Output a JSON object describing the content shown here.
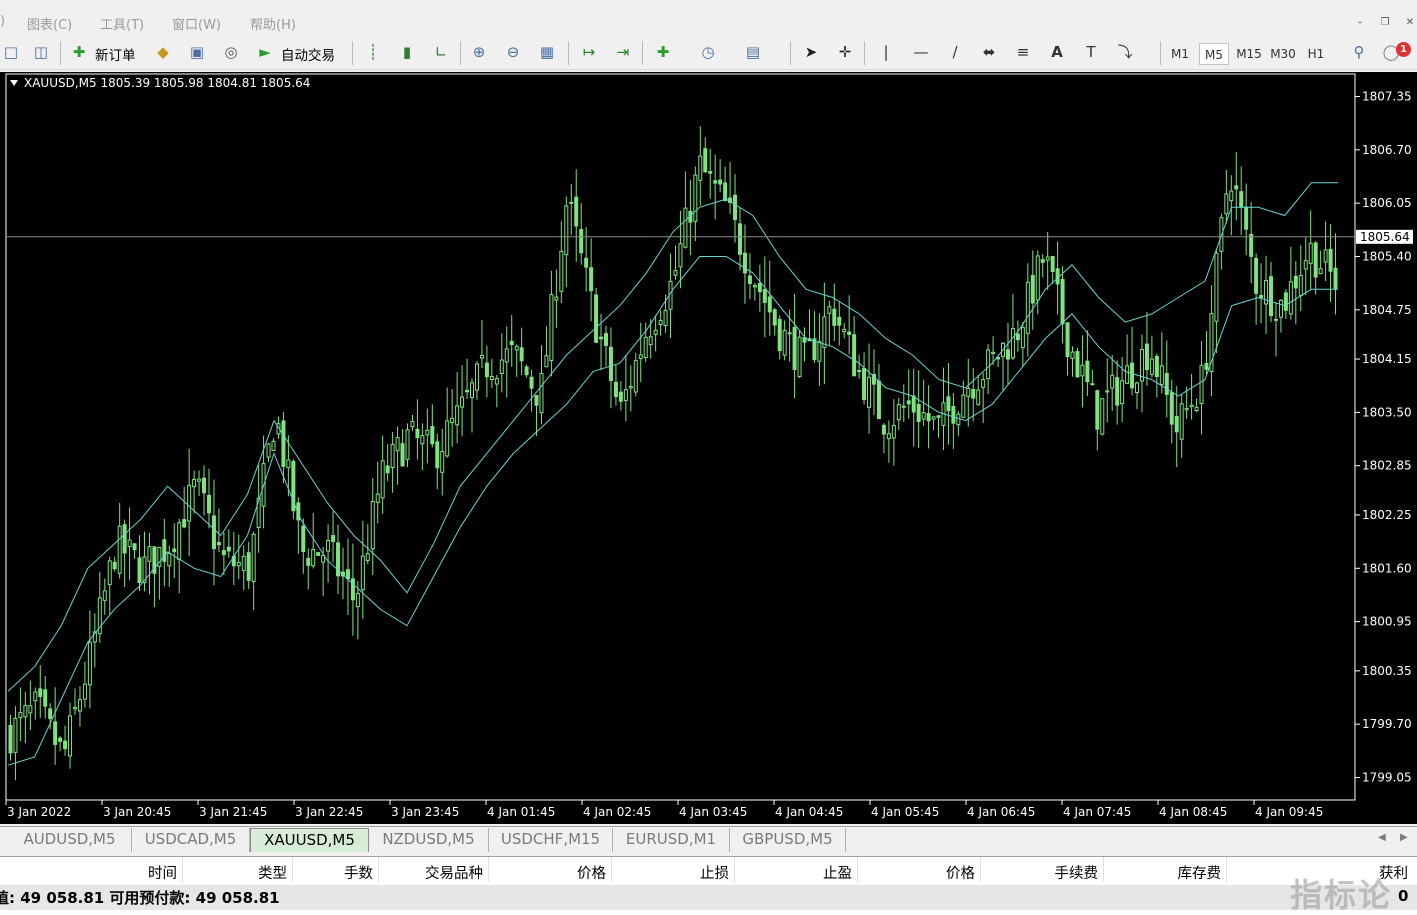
{
  "menu": {
    "items": [
      "图表(C)",
      "工具(T)",
      "窗口(W)",
      "帮助(H)"
    ],
    "partial_prefix": ")"
  },
  "toolbar": {
    "new_order_label": "新订单",
    "auto_trade_label": "自动交易",
    "timeframes": [
      "M1",
      "M5",
      "M15",
      "M30",
      "H1"
    ],
    "active_timeframe": "M5",
    "notification_count": "1",
    "icons": [
      "new-chart-icon",
      "profiles-icon",
      "new-order-icon",
      "gold-bar-icon",
      "navigator-icon",
      "signal-icon",
      "auto-trade-icon",
      "bar-chart-icon",
      "candlestick-icon",
      "line-chart-icon",
      "zoom-in-icon",
      "zoom-out-icon",
      "tile-windows-icon",
      "chart-shift-icon",
      "autoscroll-icon",
      "indicators-icon",
      "periods-clock-icon",
      "templates-icon",
      "cursor-icon",
      "crosshair-icon",
      "vertical-line-icon",
      "horizontal-line-icon",
      "trendline-icon",
      "equidistant-channel-icon",
      "fibonacci-icon",
      "text-icon",
      "text-label-icon",
      "arrows-icon",
      "search-icon",
      "chat-icon"
    ]
  },
  "chart": {
    "header": "XAUUSD,M5  1805.39 1805.98 1804.81 1805.64",
    "colors": {
      "background": "#000000",
      "candle": "#7fe37f",
      "ma": "#66d4d4",
      "bid_line": "#888888",
      "text": "#ffffff"
    }
  },
  "chart_data": {
    "type": "candlestick",
    "symbol": "XAUUSD",
    "timeframe": "M5",
    "last_ohlc": {
      "open": 1805.39,
      "high": 1805.98,
      "low": 1804.81,
      "close": 1805.64
    },
    "current_price": "1805.64",
    "ylim": [
      1798.8,
      1807.6
    ],
    "y_ticks": [
      "1807.35",
      "1806.70",
      "1806.05",
      "1805.40",
      "1804.75",
      "1804.15",
      "1803.50",
      "1802.85",
      "1802.25",
      "1801.60",
      "1800.95",
      "1800.35",
      "1799.70",
      "1799.05"
    ],
    "x_ticks": [
      "3 Jan 2022",
      "3 Jan 20:45",
      "3 Jan 21:45",
      "3 Jan 22:45",
      "3 Jan 23:45",
      "4 Jan 01:45",
      "4 Jan 02:45",
      "4 Jan 03:45",
      "4 Jan 04:45",
      "4 Jan 05:45",
      "4 Jan 06:45",
      "4 Jan 07:45",
      "4 Jan 08:45",
      "4 Jan 09:45"
    ],
    "close_path": [
      1799.6,
      1799.9,
      1799.3,
      1800.5,
      1801.9,
      1801.6,
      1801.9,
      1802.6,
      1801.7,
      1801.6,
      1803.5,
      1801.8,
      1801.8,
      1801.2,
      1802.7,
      1803.2,
      1803.0,
      1803.5,
      1804.1,
      1804.2,
      1803.7,
      1806.1,
      1804.7,
      1803.5,
      1804.5,
      1805.1,
      1806.5,
      1806.0,
      1805.2,
      1804.5,
      1804.1,
      1804.8,
      1804.0,
      1803.4,
      1803.6,
      1803.3,
      1803.8,
      1804.1,
      1804.5,
      1805.4,
      1804.3,
      1803.5,
      1803.9,
      1804.3,
      1803.3,
      1803.9,
      1806.5,
      1805.1,
      1804.8,
      1805.5,
      1805.1
    ],
    "ma_upper": [
      1800.1,
      1800.4,
      1800.9,
      1801.6,
      1801.9,
      1802.2,
      1802.6,
      1802.3,
      1802.0,
      1802.5,
      1803.4,
      1802.9,
      1802.4,
      1802.0,
      1801.7,
      1801.3,
      1801.9,
      1802.6,
      1803.0,
      1803.4,
      1803.8,
      1804.2,
      1804.5,
      1804.8,
      1805.2,
      1805.7,
      1806.0,
      1806.1,
      1805.9,
      1805.4,
      1805.0,
      1804.9,
      1804.7,
      1804.4,
      1804.2,
      1803.9,
      1803.8,
      1804.1,
      1804.5,
      1805.0,
      1805.3,
      1804.9,
      1804.6,
      1804.7,
      1804.9,
      1805.1,
      1806.0,
      1806.0,
      1805.9,
      1806.3,
      1806.3
    ],
    "ma_lower": [
      1799.2,
      1799.3,
      1800.0,
      1800.7,
      1801.1,
      1801.4,
      1801.8,
      1801.6,
      1801.5,
      1802.0,
      1803.0,
      1802.2,
      1801.7,
      1801.4,
      1801.1,
      1800.9,
      1801.5,
      1802.1,
      1802.6,
      1803.0,
      1803.3,
      1803.6,
      1804.0,
      1804.1,
      1804.5,
      1805.0,
      1805.4,
      1805.4,
      1805.2,
      1804.8,
      1804.4,
      1804.3,
      1804.1,
      1803.8,
      1803.7,
      1803.5,
      1803.4,
      1803.6,
      1804.0,
      1804.4,
      1804.7,
      1804.3,
      1804.0,
      1803.9,
      1803.7,
      1803.9,
      1804.8,
      1804.9,
      1804.8,
      1805.0,
      1805.0
    ]
  },
  "tabs": [
    "AUDUSD,M5",
    "USDCAD,M5",
    "XAUUSD,M5",
    "NZDUSD,M5",
    "USDCHF,M15",
    "EURUSD,M1",
    "GBPUSD,M5"
  ],
  "active_tab": "XAUUSD,M5",
  "terminal": {
    "columns": [
      "时间",
      "类型",
      "手数",
      "交易品种",
      "价格",
      "止损",
      "止盈",
      "价格",
      "手续费",
      "库存费",
      "获利"
    ],
    "balance_text": "值: 49 058.81  可用预付款: 49 058.81",
    "profit_total": "0"
  },
  "watermark": "指标论"
}
